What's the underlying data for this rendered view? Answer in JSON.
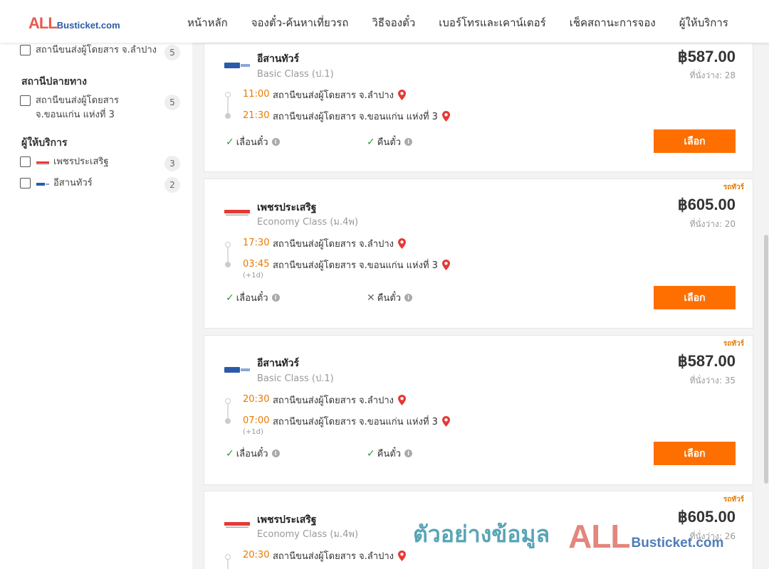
{
  "header": {
    "logo_all": "ALL",
    "logo_rest": "Busticket.com",
    "nav": [
      "หน้าหลัก",
      "จองตั๋ว-ค้นหาเที่ยวรถ",
      "วิธีจองตั๋ว",
      "เบอร์โทรและเคาน์เตอร์",
      "เช็คสถานะการจอง",
      "ผู้ให้บริการ"
    ]
  },
  "sidebar": {
    "origin_item": {
      "label": "สถานีขนส่งผู้โดยสาร จ.ลำปาง",
      "count": "5"
    },
    "dest_heading": "สถานีปลายทาง",
    "dest_item": {
      "label_line1": "สถานีขนส่งผู้โดยสาร",
      "label_line2": "จ.ขอนแก่น แห่งที่ 3",
      "count": "5"
    },
    "operator_heading": "ผู้ให้บริการ",
    "operators": [
      {
        "label": "เพชรประเสริฐ",
        "count": "3"
      },
      {
        "label": "อีสานทัวร์",
        "count": "2"
      }
    ]
  },
  "cards": [
    {
      "badge": "",
      "operator": "อีสานทัวร์",
      "class": "Basic Class (ป.1)",
      "price": "฿587.00",
      "seats": "ที่นั่งว่าง: 28",
      "dep_time": "11:00",
      "dep_stop": "สถานีขนส่งผู้โดยสาร จ.ลำปาง",
      "arr_time": "21:30",
      "arr_stop": "สถานีขนส่งผู้โดยสาร จ.ขอนแก่น แห่งที่ 3",
      "plus_day": "",
      "feat1": "เลื่อนตั๋ว",
      "feat2": "คืนตั๋ว",
      "button": "เลือก"
    },
    {
      "badge": "รถทัวร์",
      "operator": "เพชรประเสริฐ",
      "class": "Economy Class (ม.4พ)",
      "price": "฿605.00",
      "seats": "ที่นั่งว่าง: 20",
      "dep_time": "17:30",
      "dep_stop": "สถานีขนส่งผู้โดยสาร จ.ลำปาง",
      "arr_time": "03:45",
      "arr_stop": "สถานีขนส่งผู้โดยสาร จ.ขอนแก่น แห่งที่ 3",
      "plus_day": "(+1d)",
      "feat1": "เลื่อนตั๋ว",
      "feat2": "คืนตั๋ว",
      "button": "เลือก"
    },
    {
      "badge": "รถทัวร์",
      "operator": "อีสานทัวร์",
      "class": "Basic Class (ป.1)",
      "price": "฿587.00",
      "seats": "ที่นั่งว่าง: 35",
      "dep_time": "20:30",
      "dep_stop": "สถานีขนส่งผู้โดยสาร จ.ลำปาง",
      "arr_time": "07:00",
      "arr_stop": "สถานีขนส่งผู้โดยสาร จ.ขอนแก่น แห่งที่ 3",
      "plus_day": "(+1d)",
      "feat1": "เลื่อนตั๋ว",
      "feat2": "คืนตั๋ว",
      "button": "เลือก"
    },
    {
      "badge": "รถทัวร์",
      "operator": "เพชรประเสริฐ",
      "class": "Economy Class (ม.4พ)",
      "price": "฿605.00",
      "seats": "ที่นั่งว่าง: 26",
      "dep_time": "20:30",
      "dep_stop": "สถานีขนส่งผู้โดยสาร จ.ลำปาง"
    }
  ],
  "watermark": {
    "text": "ตัวอย่างข้อมูล",
    "all": "ALL",
    "rest": "Busticket.com"
  },
  "colors": {
    "accent": "#ff6f00",
    "time": "#e87a00",
    "check": "#2e9a3a",
    "pin": "#e53935"
  }
}
